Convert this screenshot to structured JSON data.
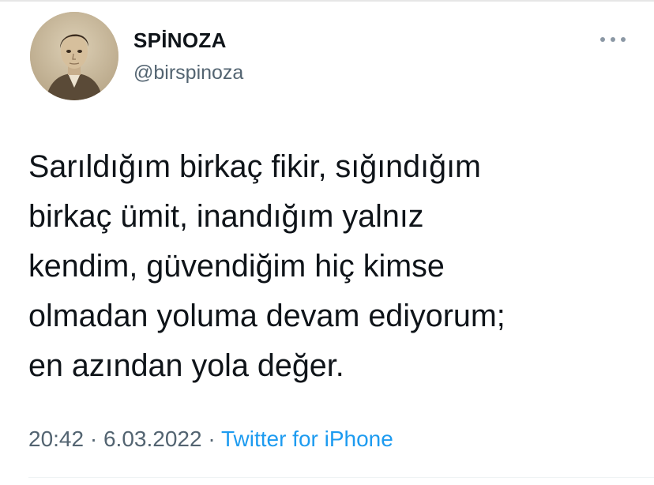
{
  "user": {
    "display_name": "SPİNOZA",
    "handle": "@birspinoza",
    "avatar_icon": "sepia-portrait-avatar"
  },
  "more_icon": "more-horizontal-icon",
  "tweet": {
    "lines": [
      "Sarıldığım birkaç fikir, sığındığım",
      "birkaç ümit, inandığım yalnız",
      "kendim, güvendiğim hiç kimse",
      "olmadan yoluma devam ediyorum;",
      "en azından yola değer."
    ]
  },
  "meta": {
    "time": "20:42",
    "separator": "·",
    "date": "6.03.2022",
    "source": "Twitter for iPhone"
  },
  "colors": {
    "text": "#0f1419",
    "secondary": "#536471",
    "link": "#1d9bf0"
  }
}
